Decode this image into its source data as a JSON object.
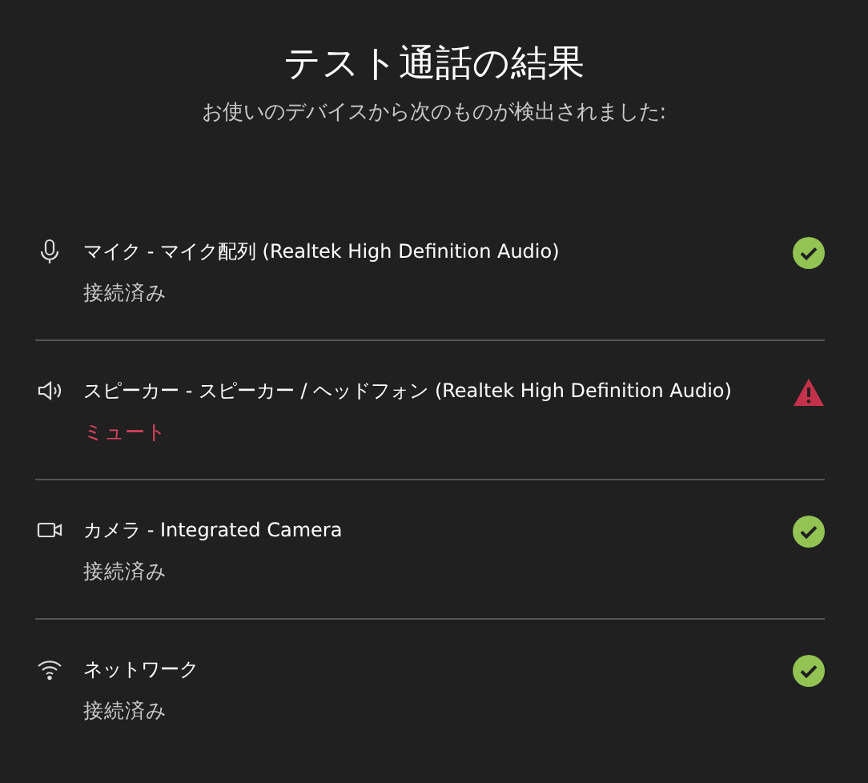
{
  "title": "テスト通話の結果",
  "subtitle": "お使いのデバイスから次のものが検出されました:",
  "devices": [
    {
      "kind": "microphone",
      "name": "マイク - マイク配列 (Realtek High Definition Audio)",
      "status_text": "接続済み",
      "warning": false
    },
    {
      "kind": "speaker",
      "name": "スピーカー - スピーカー / ヘッドフォン (Realtek High Definition Audio)",
      "status_text": "ミュート",
      "warning": true
    },
    {
      "kind": "camera",
      "name": "カメラ - Integrated Camera",
      "status_text": "接続済み",
      "warning": false
    },
    {
      "kind": "network",
      "name": "ネットワーク",
      "status_text": "接続済み",
      "warning": false
    }
  ]
}
